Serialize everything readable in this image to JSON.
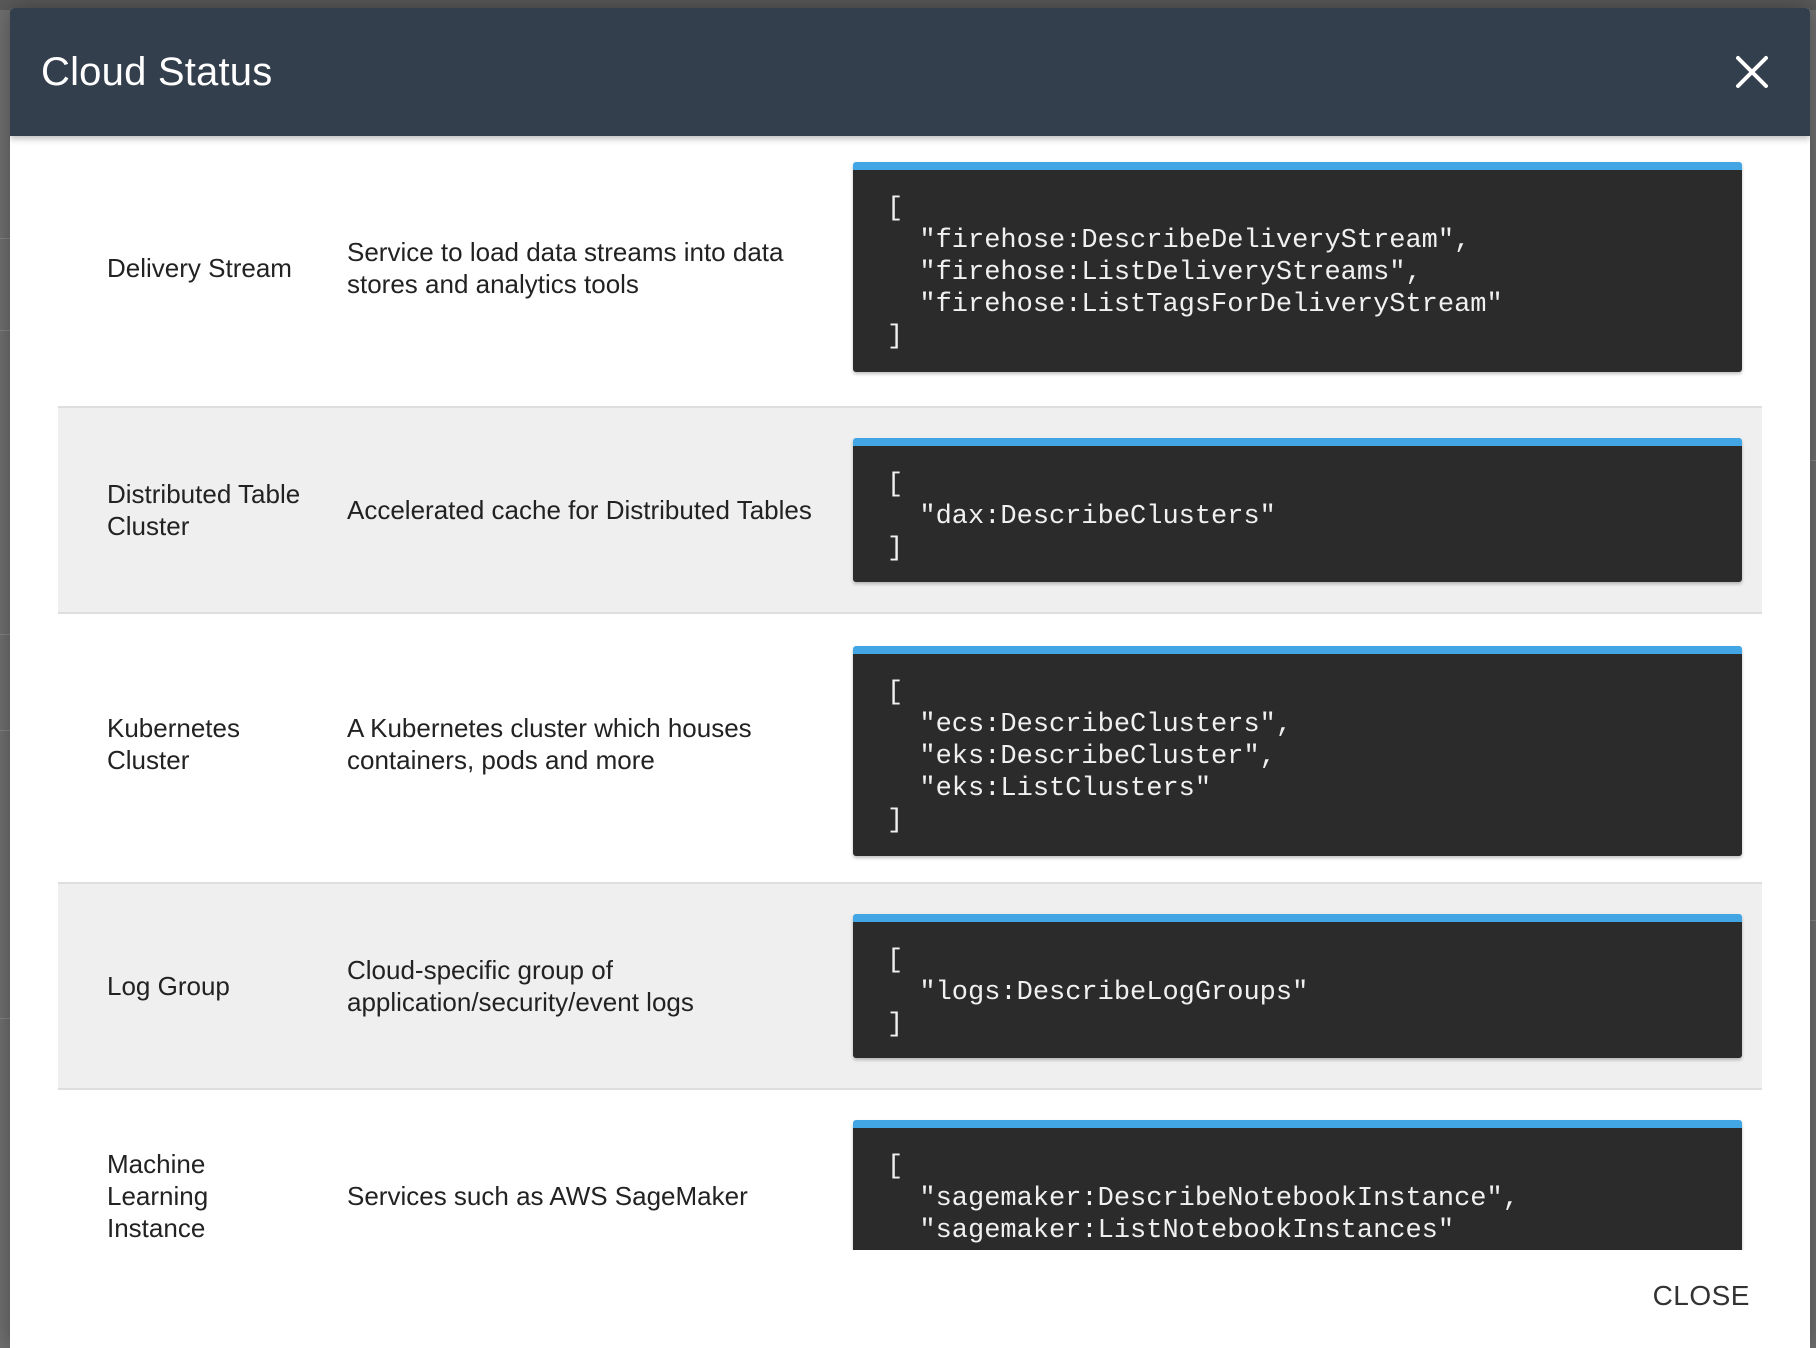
{
  "modal": {
    "title": "Cloud Status",
    "close_icon": "close-icon",
    "footer": {
      "close_label": "CLOSE"
    }
  },
  "colors": {
    "header_bg": "#333f4d",
    "code_bg": "#2b2b2b",
    "code_accent": "#42a5e4",
    "alt_row_bg": "#efefef"
  },
  "rows": [
    {
      "name": "Delivery Stream",
      "description": "Service to load data streams into data stores and analytics tools",
      "code": [
        "[",
        "  \"firehose:DescribeDeliveryStream\",",
        "  \"firehose:ListDeliveryStreams\",",
        "  \"firehose:ListTagsForDeliveryStream\"",
        "]"
      ]
    },
    {
      "name": "Distributed Table Cluster",
      "description": "Accelerated cache for Distributed Tables",
      "code": [
        "[",
        "  \"dax:DescribeClusters\"",
        "]"
      ]
    },
    {
      "name": "Kubernetes Cluster",
      "description": "A Kubernetes cluster which houses containers, pods and more",
      "code": [
        "[",
        "  \"ecs:DescribeClusters\",",
        "  \"eks:DescribeCluster\",",
        "  \"eks:ListClusters\"",
        "]"
      ]
    },
    {
      "name": "Log Group",
      "description": "Cloud-specific group of application/security/event logs",
      "code": [
        "[",
        "  \"logs:DescribeLogGroups\"",
        "]"
      ]
    },
    {
      "name": "Machine Learning Instance",
      "description": "Services such as AWS SageMaker",
      "code": [
        "[",
        "  \"sagemaker:DescribeNotebookInstance\",",
        "  \"sagemaker:ListNotebookInstances\""
      ]
    }
  ]
}
